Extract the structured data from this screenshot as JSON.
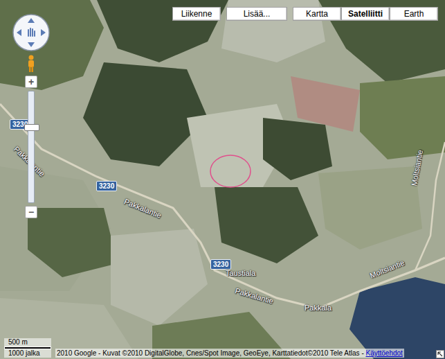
{
  "toolbar": [
    {
      "label": "Liikenne",
      "selected": false
    },
    {
      "label": "Lisää...",
      "selected": false
    }
  ],
  "map_types": [
    {
      "label": "Kartta",
      "selected": false
    },
    {
      "label": "Satelliitti",
      "selected": true
    },
    {
      "label": "Earth",
      "selected": false
    }
  ],
  "zoom": {
    "plus": "+",
    "minus": "−",
    "level": 0.69
  },
  "labels": [
    {
      "text": "3230",
      "kind": "shield"
    },
    {
      "text": "Pakkalantie",
      "kind": "road"
    },
    {
      "text": "3230",
      "kind": "shield"
    },
    {
      "text": "Pakkalantie",
      "kind": "road"
    },
    {
      "text": "3230",
      "kind": "shield"
    },
    {
      "text": "Taustiala",
      "kind": "place"
    },
    {
      "text": "Pakkalantie",
      "kind": "road"
    },
    {
      "text": "Pakkala",
      "kind": "place"
    },
    {
      "text": "Moltsiantie",
      "kind": "road"
    },
    {
      "text": "Moltsiantie",
      "kind": "road"
    }
  ],
  "scale": {
    "metric": "500 m",
    "imperial": "1000 jalka"
  },
  "copyright": {
    "text": "2010 Google - Kuvat ©2010 DigitalGlobe, Cnes/Spot Image, GeoEye, Karttatiedot©2010 Tele Atlas - ",
    "link": "Käyttöehdot"
  }
}
